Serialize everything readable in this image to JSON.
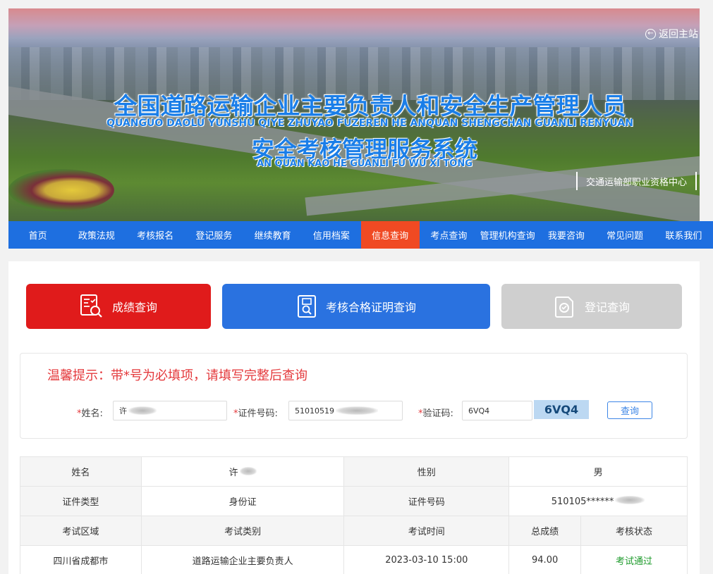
{
  "banner": {
    "back_home": "返回主站",
    "title_main": "全国道路运输企业主要负责人和安全生产管理人员",
    "title_main_pinyin": "QUANGUO DAOLU YUNSHU QIYE ZHUYAO FUZEREN HE ANQUAN SHENGCHAN GUANLI RENYUAN",
    "title_sub": "安全考核管理服务系统",
    "title_sub_pinyin": "AN QUAN KAO HE GUANLI FU WU XI TONG",
    "center_tag": "交通运输部职业资格中心"
  },
  "nav": {
    "items": [
      "首页",
      "政策法规",
      "考核报名",
      "登记服务",
      "继续教育",
      "信用档案",
      "信息查询",
      "考点查询",
      "管理机构查询",
      "我要咨询",
      "常见问题",
      "联系我们"
    ],
    "active_index": 6
  },
  "query_tabs": [
    {
      "label": "成绩查询",
      "icon": "score-report-icon",
      "color": "#e01b1b"
    },
    {
      "label": "考核合格证明查询",
      "icon": "certificate-search-icon",
      "color": "#2a72e0"
    },
    {
      "label": "登记查询",
      "icon": "registration-icon",
      "color": "#cfcfcf"
    }
  ],
  "form": {
    "tip": "温馨提示：带*号为必填项，请填写完整后查询",
    "name_label": "姓名:",
    "name_value": "许",
    "id_label": "证件号码:",
    "id_value": "51010519",
    "captcha_label": "验证码:",
    "captcha_value": "6VQ4",
    "captcha_image_text": "6VQ4",
    "search_button": "查询"
  },
  "result": {
    "row1": {
      "name_header": "姓名",
      "name_value": "许",
      "gender_header": "性别",
      "gender_value": "男"
    },
    "row2": {
      "id_type_header": "证件类型",
      "id_type_value": "身份证",
      "id_no_header": "证件号码",
      "id_no_value": "510105******"
    },
    "headers": [
      "考试区域",
      "考试类别",
      "考试时间",
      "总成绩",
      "考核状态"
    ],
    "rows": [
      [
        "四川省成都市",
        "道路运输企业主要负责人",
        "2023-03-10 15:00",
        "94.00",
        "考试通过"
      ]
    ]
  },
  "colors": {
    "nav_bg": "#1e6fe0",
    "nav_active": "#f04a23",
    "tip": "#e4393c",
    "pass": "#1e9b2c"
  }
}
